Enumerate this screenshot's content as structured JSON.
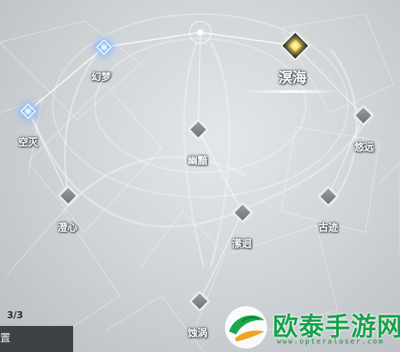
{
  "progress_text": "3/3",
  "bottom_button_label": "置",
  "nodes": [
    {
      "id": "huanmeng",
      "label": "幻梦",
      "state": "active"
    },
    {
      "id": "kongmie",
      "label": "空灭",
      "state": "active"
    },
    {
      "id": "minghai",
      "label": "溟海",
      "state": "selected"
    },
    {
      "id": "youyuan",
      "label": "悠远",
      "state": "locked"
    },
    {
      "id": "youan",
      "label": "幽黯",
      "state": "locked"
    },
    {
      "id": "chengxin",
      "label": "澄心",
      "state": "locked"
    },
    {
      "id": "guji",
      "label": "古迹",
      "state": "locked"
    },
    {
      "id": "yingjiong",
      "label": "潆迥",
      "state": "locked"
    },
    {
      "id": "shiwo",
      "label": "蚀涡",
      "state": "locked"
    }
  ],
  "watermark": {
    "text": "欧泰手游网",
    "url": "www.opteralaser.com"
  },
  "colors": {
    "active_glow": "#4a8fe8",
    "selected_core": "#ffe66a",
    "locked_fill": "#8a8f93",
    "watermark_green": "#17a34a",
    "bottom_bar": "#3e4246"
  }
}
